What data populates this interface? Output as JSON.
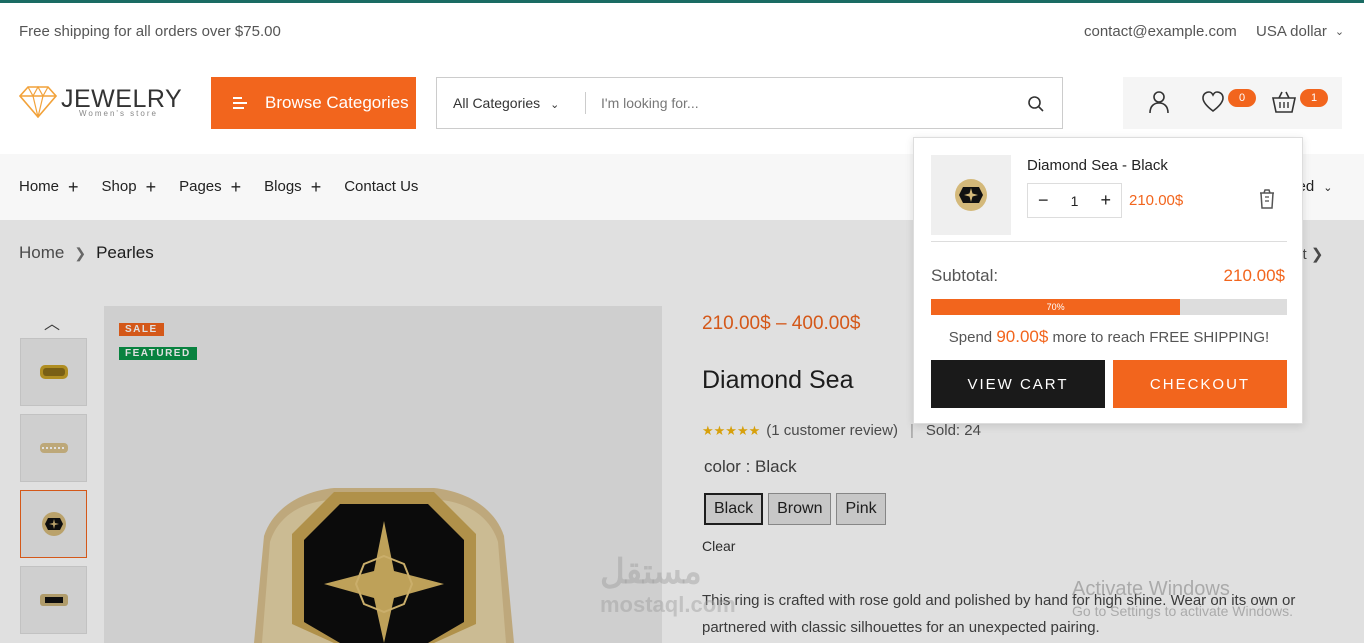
{
  "topbar": {
    "shipping_text": "Free shipping for all orders over $75.00",
    "contact_email": "contact@example.com",
    "currency": "USA dollar"
  },
  "logo": {
    "name": "JEWELRY",
    "tagline": "Women's store"
  },
  "header": {
    "browse_label": "Browse Categories",
    "search_category": "All Categories",
    "search_placeholder": "I'm looking for...",
    "wishlist_count": "0",
    "cart_count": "1"
  },
  "nav": {
    "items": [
      "Home",
      "Shop",
      "Pages",
      "Blogs",
      "Contact Us"
    ],
    "recent_label": "ved"
  },
  "breadcrumb": {
    "home": "Home",
    "current": "Pearles",
    "next": "xt"
  },
  "product": {
    "sale_label": "SALE",
    "featured_label": "FEATURED",
    "price_range": "210.00$ – 400.00$",
    "title": "Diamond Sea",
    "rating_stars": 5,
    "review_text": "(1 customer review)",
    "sold_text": "Sold: 24",
    "color_label": "color",
    "color_value": "Black",
    "colors": [
      "Black",
      "Brown",
      "Pink"
    ],
    "selected_color": "Black",
    "clear_label": "Clear",
    "description": "This ring is crafted with rose gold and polished by hand for high shine. Wear on its own or partnered with classic silhouettes for an unexpected pairing."
  },
  "mini_cart": {
    "item_name": "Diamond Sea - Black",
    "quantity": "1",
    "item_price": "210.00$",
    "subtotal_label": "Subtotal:",
    "subtotal_value": "210.00$",
    "progress_percent": 70,
    "progress_label": "70%",
    "spend_prefix": "Spend",
    "spend_amount": "90.00$",
    "spend_suffix": "more to reach FREE SHIPPING!",
    "view_cart_label": "VIEW CART",
    "checkout_label": "CHECKOUT"
  },
  "overlays": {
    "watermark_arabic": "مستقل",
    "watermark_latin": "mostaql.com",
    "activate_title": "Activate Windows",
    "activate_sub": "Go to Settings to activate Windows."
  },
  "colors": {
    "accent": "#f2651d",
    "featured": "#0a9448",
    "dark": "#1a1a1a",
    "star": "#f5b70d"
  },
  "icons": [
    "diamond-logo-icon",
    "menu-bars-icon",
    "chevron-down-icon",
    "search-icon",
    "user-icon",
    "heart-icon",
    "basket-icon",
    "plus-icon",
    "chevron-right-icon",
    "chevron-up-icon",
    "trash-icon",
    "star-icon"
  ]
}
